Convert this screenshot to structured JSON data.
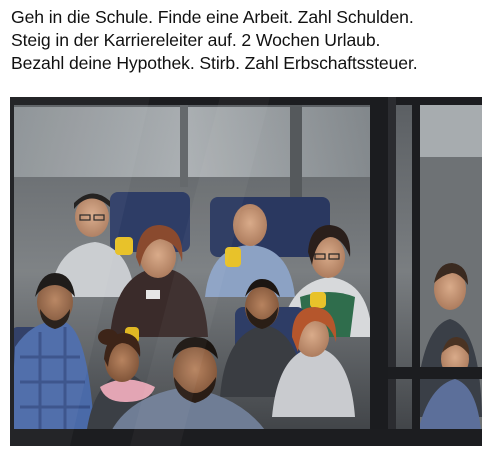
{
  "caption": {
    "lines": [
      "Geh in die Schule. Finde eine Arbeit. Zahl Schulden.",
      "Steig in der Karriereleiter auf. 2 Wochen Urlaub.",
      "Bezahl deine Hypothek. Stirb. Zahl Erbschaftssteuer."
    ]
  },
  "photo": {
    "subject": "commuters-on-train-through-window",
    "colors": {
      "frame": "#1c1d20",
      "interior": "#6b6f73",
      "window_light": "#c9cdd0",
      "seat_blue": "#2e3d66",
      "handle_yellow": "#e8c22a"
    }
  }
}
